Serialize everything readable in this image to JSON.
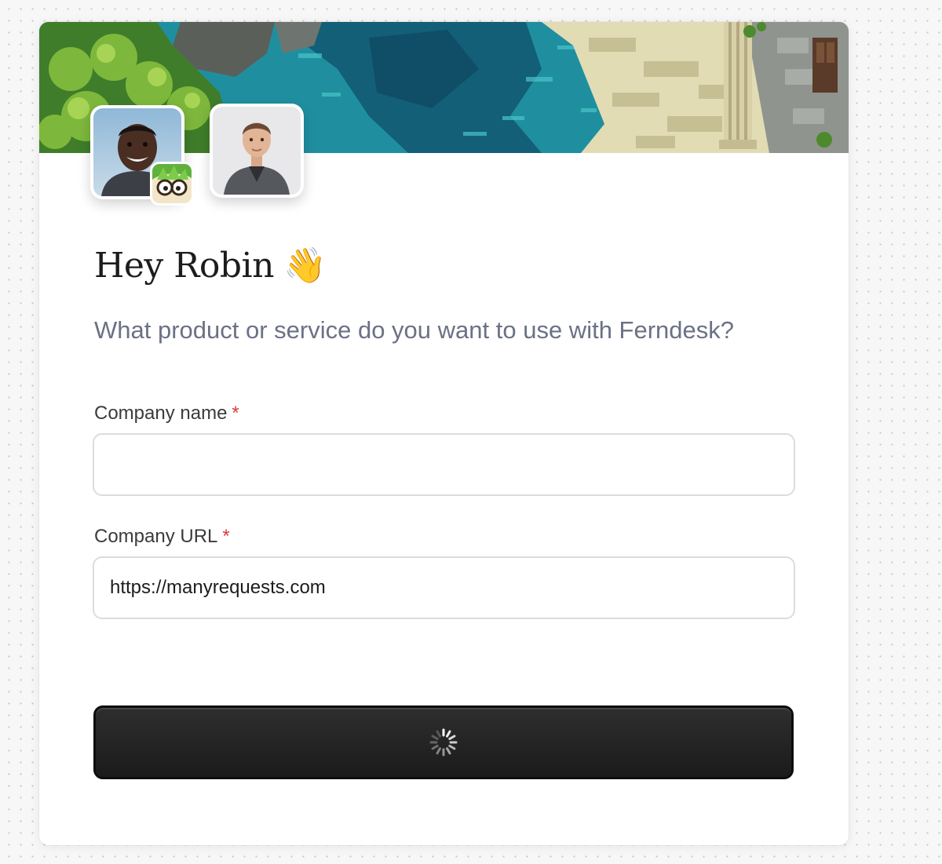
{
  "greeting": {
    "title": "Hey Robin",
    "emoji": "👋",
    "subtitle": "What product or service do you want to use with Ferndesk?"
  },
  "form": {
    "company_name": {
      "label": "Company name",
      "required_mark": "*",
      "value": "",
      "placeholder": ""
    },
    "company_url": {
      "label": "Company URL",
      "required_mark": "*",
      "value": "https://manyrequests.com"
    },
    "submit": {
      "state": "loading",
      "icon": "spinner-icon"
    }
  },
  "colors": {
    "subtitle": "#6b7185",
    "required": "#d93a3a",
    "button": "#1f1f1f"
  }
}
